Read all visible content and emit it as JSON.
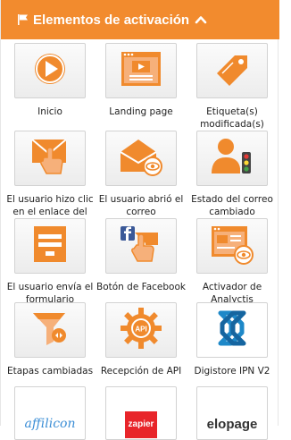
{
  "header": {
    "title": "Elementos de activación"
  },
  "tiles": [
    {
      "label": "Inicio",
      "icon": "play-icon"
    },
    {
      "label": "Landing page",
      "icon": "landing-page-icon"
    },
    {
      "label": "Etiqueta(s) modificada(s)",
      "icon": "tag-icon"
    },
    {
      "label": "El usuario hizo clic en el enlace del",
      "icon": "email-click-icon"
    },
    {
      "label": "El usuario abrió el correo",
      "icon": "email-open-icon"
    },
    {
      "label": "Estado del correo cambiado",
      "icon": "user-status-icon"
    },
    {
      "label": "El usuario envía el formulario",
      "icon": "form-icon"
    },
    {
      "label": "Botón de Facebook",
      "icon": "facebook-click-icon"
    },
    {
      "label": "Activador de Analyctis",
      "icon": "analytics-icon"
    },
    {
      "label": "Etapas cambiadas",
      "icon": "funnel-icon"
    },
    {
      "label": "Recepción de API",
      "icon": "api-gear-icon"
    },
    {
      "label": "Digistore IPN V2",
      "icon": "digistore-icon"
    }
  ],
  "partial_tiles": [
    {
      "text": "affilicon",
      "icon": "affilicon-logo"
    },
    {
      "text": "zapier",
      "icon": "zapier-logo"
    },
    {
      "text": "elopage",
      "icon": "elopage-logo"
    }
  ],
  "colors": {
    "header": "#f28b2e",
    "accent": "#f08a2d",
    "tile_bg": "#f2f2f2"
  }
}
